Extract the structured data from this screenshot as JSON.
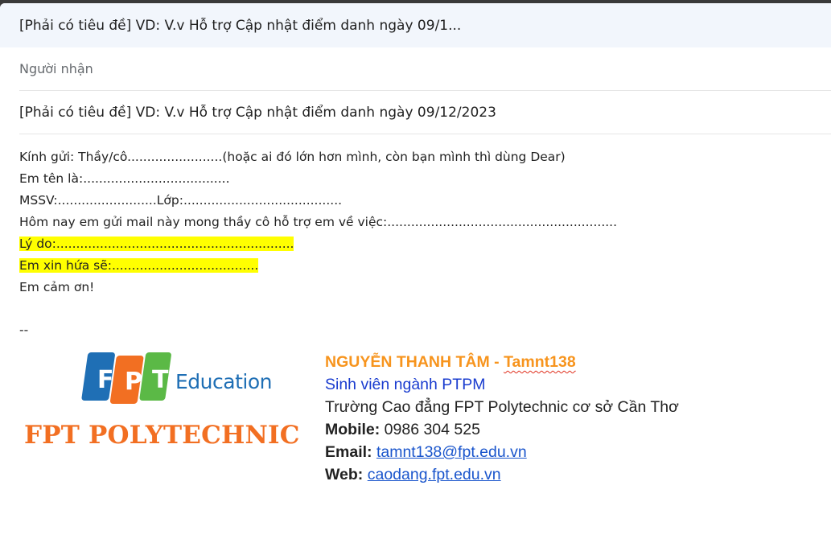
{
  "window": {
    "title": "[Phải có tiêu đề] VD: V.v Hỗ trợ Cập nhật điểm danh ngày 09/1..."
  },
  "compose": {
    "recipients_placeholder": "Người nhận",
    "subject": "[Phải có tiêu đề] VD: V.v Hỗ trợ Cập nhật điểm danh ngày 09/12/2023"
  },
  "body": {
    "greeting": "Kính gửi: Thầy/cô........................(hoặc ai đó lớn hơn mình, còn bạn mình thì dùng Dear)",
    "name_line": "Em tên là:.....................................",
    "mssv_line": "MSSV:.........................Lớp:........................................",
    "request_line": "Hôm nay em gửi mail này mong thầy cô hỗ trợ em về việc:..........................................................",
    "reason_line": "Lý do:............................................................",
    "promise_line": "Em xin hứa sẽ:.....................................",
    "thanks_line": "Em cảm ơn!",
    "sig_separator": "--"
  },
  "signature": {
    "logo_top_letters": [
      "F",
      "P",
      "T"
    ],
    "logo_edu_text": "Education",
    "logo_poly_text": "FPT POLYTECHNIC",
    "name_prefix": "NGUYỄN THANH TÂM - ",
    "username": "Tamnt138",
    "role": "Sinh viên ngành PTPM",
    "school": "Trường Cao đẳng FPT Polytechnic cơ sở Cần Thơ",
    "mobile_label": "Mobile:",
    "mobile_value": " 0986 304 525",
    "email_label": "Email:",
    "email_value": "tamnt138@fpt.edu.vn",
    "web_label": "Web:",
    "web_value": "caodang.fpt.edu.vn"
  },
  "colors": {
    "highlight": "#ffff00",
    "name_orange": "#f7941d",
    "role_blue": "#1a3ccf",
    "link_blue": "#1a55cc",
    "fpt_blue": "#1f6fb5",
    "fpt_orange": "#f26f22",
    "fpt_green": "#5bb946"
  }
}
